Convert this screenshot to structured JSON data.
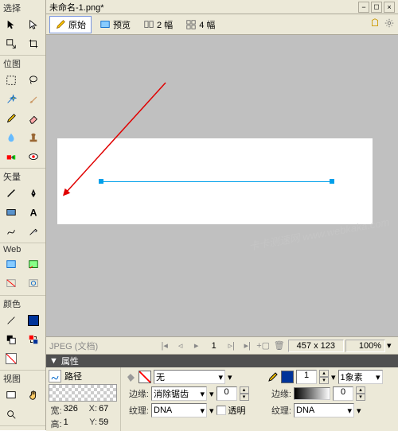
{
  "title": "未命名-1.png*",
  "tabs": {
    "original": "原始",
    "preview": "预览",
    "two": "2 幅",
    "four": "4 幅"
  },
  "palette": {
    "select": "选择",
    "bitmap": "位图",
    "vector": "矢量",
    "web": "Web",
    "color": "颜色",
    "view": "视图"
  },
  "status": {
    "format": "JPEG (文档)",
    "page": "1",
    "dims": "457 x 123",
    "zoom": "100%"
  },
  "props": {
    "title": "属性",
    "path": "路径",
    "w_label": "宽:",
    "w": "326",
    "h_label": "高:",
    "h": "1",
    "x_label": "X:",
    "x": "67",
    "y_label": "Y:",
    "y": "59",
    "fill": "无",
    "edge_label": "边缘:",
    "edge": "消除锯齿",
    "edge_val": "0",
    "texture_label": "纹理:",
    "texture": "DNA",
    "transparent_label": "透明",
    "stroke_w": "1",
    "stroke_unit": "1象素",
    "edge2_label": "边缘:",
    "edge2_val": "0",
    "texture2_label": "纹理:",
    "texture2": "DNA"
  },
  "watermark": "卡卡测速网  www.webkaka.com"
}
